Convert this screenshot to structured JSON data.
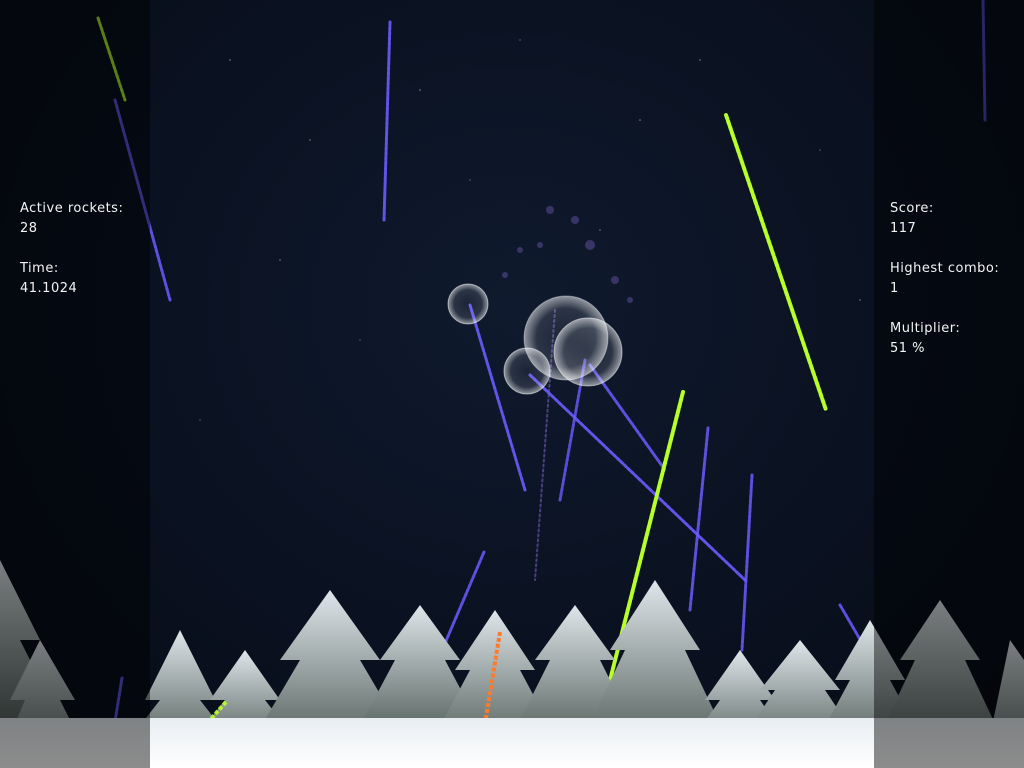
{
  "hud_left": {
    "active_rockets_label": "Active rockets:",
    "active_rockets_value": "28",
    "time_label": "Time:",
    "time_value": "41.1024"
  },
  "hud_right": {
    "score_label": "Score:",
    "score_value": "117",
    "highest_combo_label": "Highest combo:",
    "highest_combo_value": "1",
    "multiplier_label": "Multiplier:",
    "multiplier_value": "51 %"
  },
  "colors": {
    "sky": "#0a1120",
    "rocket_blue": "#6a5cff",
    "rocket_green": "#b8ff2a",
    "rocket_orange": "#ff7a2a",
    "snow": "#ffffff"
  }
}
